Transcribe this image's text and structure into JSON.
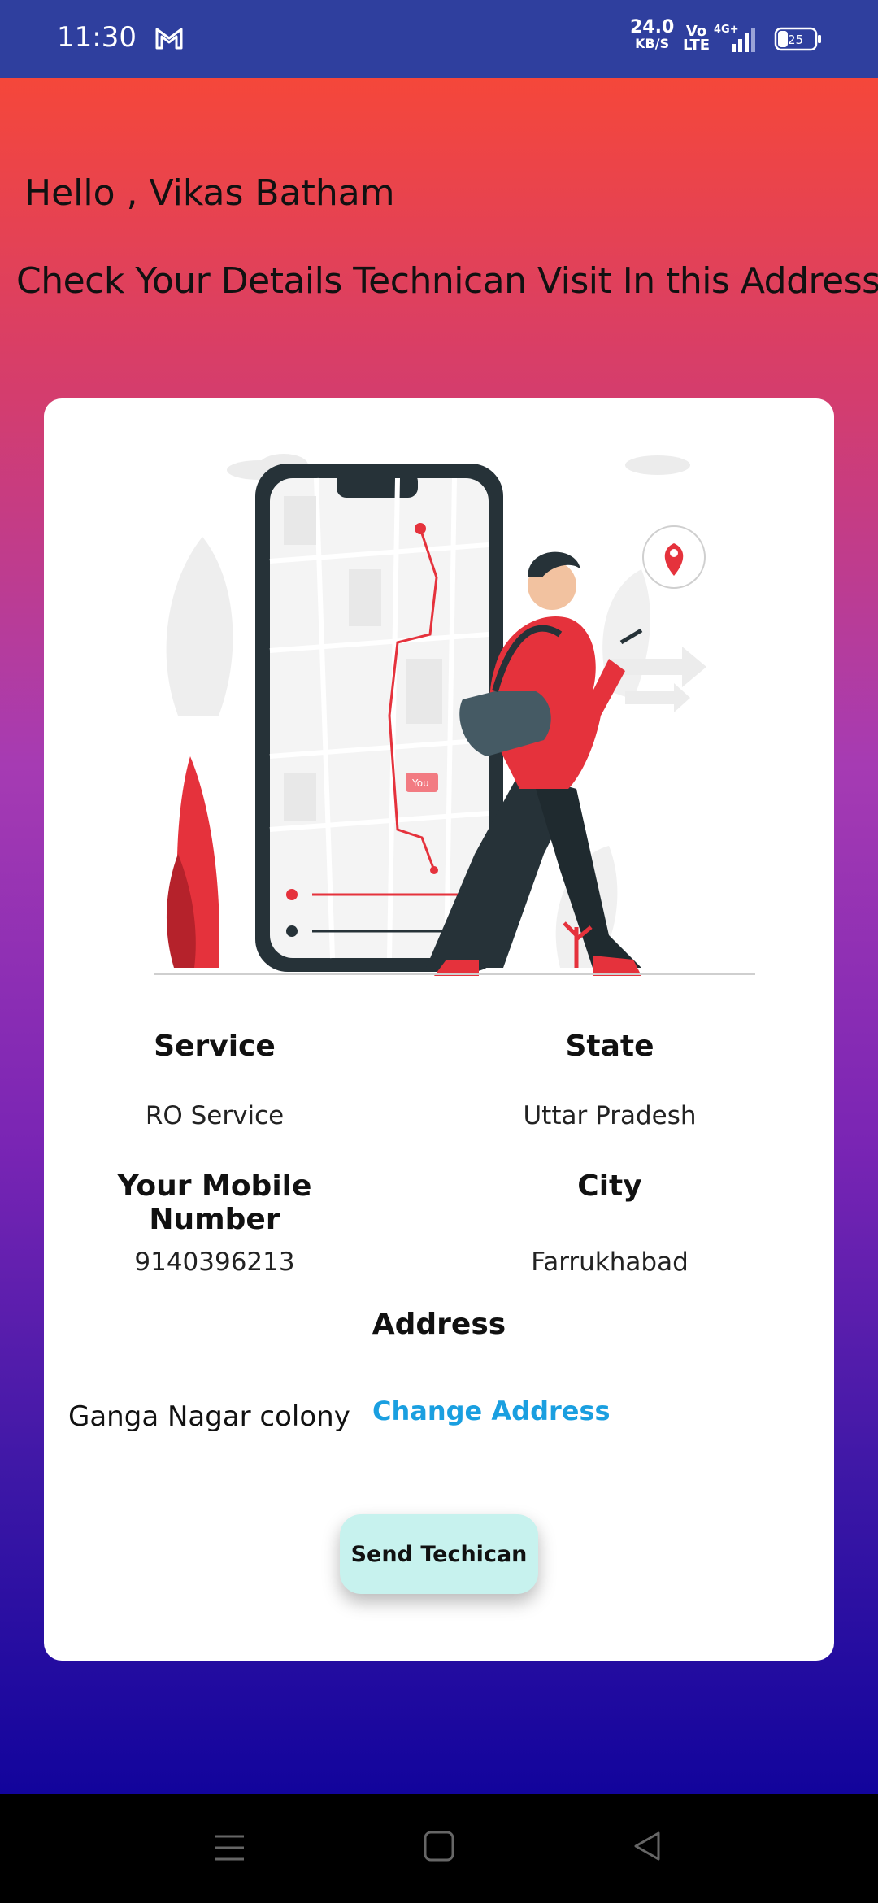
{
  "status_bar": {
    "time": "11:30",
    "net_speed": "24.0",
    "net_speed_unit": "KB/S",
    "volte": "Vo",
    "volte_sub": "LTE",
    "network": "4G+",
    "battery": "25",
    "icons": [
      "gmail-icon",
      "signal-icon",
      "battery-icon"
    ]
  },
  "greeting": "Hello , Vikas Batham",
  "subtitle": "Check Your Details Technican Visit In this Address",
  "details": {
    "service_label": "Service",
    "service_value": "RO Service",
    "state_label": "State",
    "state_value": "Uttar Pradesh",
    "mobile_label": "Your Mobile Number",
    "mobile_value": "9140396213",
    "city_label": "City",
    "city_value": "Farrukhabad",
    "address_label": "Address",
    "address_value": "Ganga Nagar colony",
    "change_address": "Change Address"
  },
  "illustration_text": "You",
  "send_button": "Send Techican",
  "nav": [
    "menu-icon",
    "home-icon",
    "back-icon"
  ],
  "colors": {
    "status_bar": "#2f3f9e",
    "gradient_top": "#f5473a",
    "gradient_bottom": "#12049c",
    "link": "#1a9fe0",
    "button": "#c7f2ee"
  }
}
